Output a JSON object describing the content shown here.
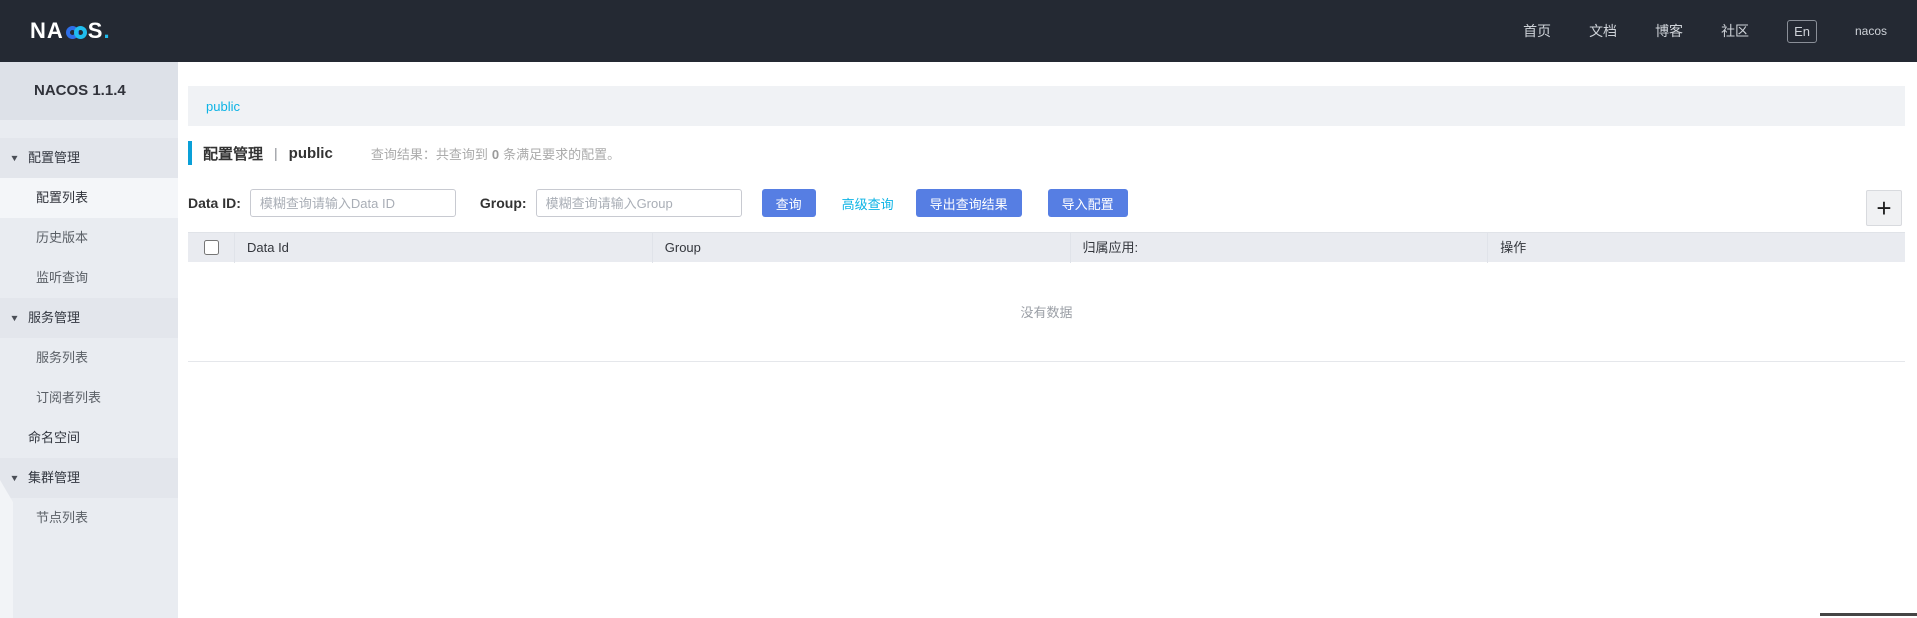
{
  "topbar": {
    "logo": {
      "left": "NA",
      "right": "S",
      "dot": "."
    },
    "nav": [
      {
        "label": "首页"
      },
      {
        "label": "文档"
      },
      {
        "label": "博客"
      },
      {
        "label": "社区"
      }
    ],
    "lang": "En",
    "user": "nacos"
  },
  "sidebar": {
    "version": "NACOS 1.1.4",
    "menu": [
      {
        "label": "配置管理"
      },
      {
        "label": "配置列表"
      },
      {
        "label": "历史版本"
      },
      {
        "label": "监听查询"
      },
      {
        "label": "服务管理"
      },
      {
        "label": "服务列表"
      },
      {
        "label": "订阅者列表"
      },
      {
        "label": "命名空间"
      },
      {
        "label": "集群管理"
      },
      {
        "label": "节点列表"
      }
    ]
  },
  "namespace_bar": {
    "current": "public"
  },
  "page": {
    "title": "配置管理",
    "separator": "|",
    "namespace": "public",
    "result_prefix": "查询结果：共查询到",
    "result_count": "0",
    "result_suffix": "条满足要求的配置。"
  },
  "toolbar": {
    "dataid_label": "Data ID:",
    "dataid_placeholder": "模糊查询请输入Data ID",
    "group_label": "Group:",
    "group_placeholder": "模糊查询请输入Group",
    "query": "查询",
    "advanced": "高级查询",
    "export": "导出查询结果",
    "import": "导入配置",
    "add": "+"
  },
  "table": {
    "columns": [
      {
        "label": "Data Id"
      },
      {
        "label": "Group"
      },
      {
        "label": "归属应用:"
      },
      {
        "label": "操作"
      }
    ],
    "empty": "没有数据"
  },
  "icons": {
    "caret_down": "▼"
  },
  "colors": {
    "accent_cyan": "#0cb3e5",
    "button_blue": "#567ee3",
    "topbar_bg": "#242933"
  }
}
